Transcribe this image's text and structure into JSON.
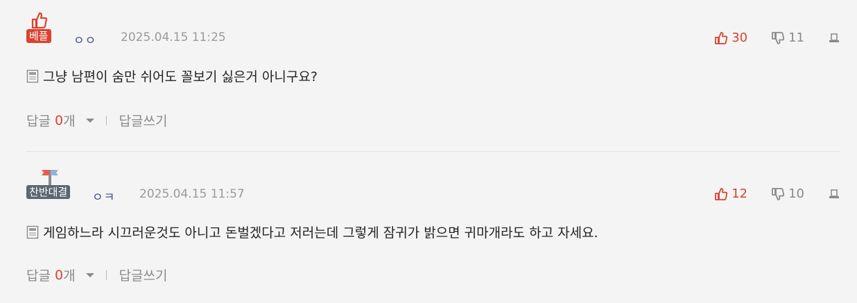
{
  "comments": [
    {
      "badge_label": "베플",
      "badge_icon": "thumbs-up-icon",
      "nickname": "ㅇㅇ",
      "datetime": "2025.04.15 11:25",
      "likes": "30",
      "dislikes": "11",
      "text": "그냥 남편이 숨만 쉬어도 꼴보기 싫은거 아니구요?",
      "reply_label": "답글",
      "reply_count": "0",
      "reply_unit": "개",
      "write_reply_label": "답글쓰기"
    },
    {
      "badge_label": "찬반대결",
      "badge_icon": "flags-icon",
      "nickname": "ㅇㅋ",
      "datetime": "2025.04.15 11:57",
      "likes": "12",
      "dislikes": "10",
      "text": "게임하느라 시끄러운것도 아니고 돈벌겠다고 저러는데 그렇게 잠귀가 밝으면 귀마개라도 하고 자세요.",
      "reply_label": "답글",
      "reply_count": "0",
      "reply_unit": "개",
      "write_reply_label": "답글쓰기"
    }
  ],
  "colors": {
    "accent_red": "#d9432f",
    "nickname_blue": "#3c4e8e",
    "debate_badge": "#5b6770"
  }
}
